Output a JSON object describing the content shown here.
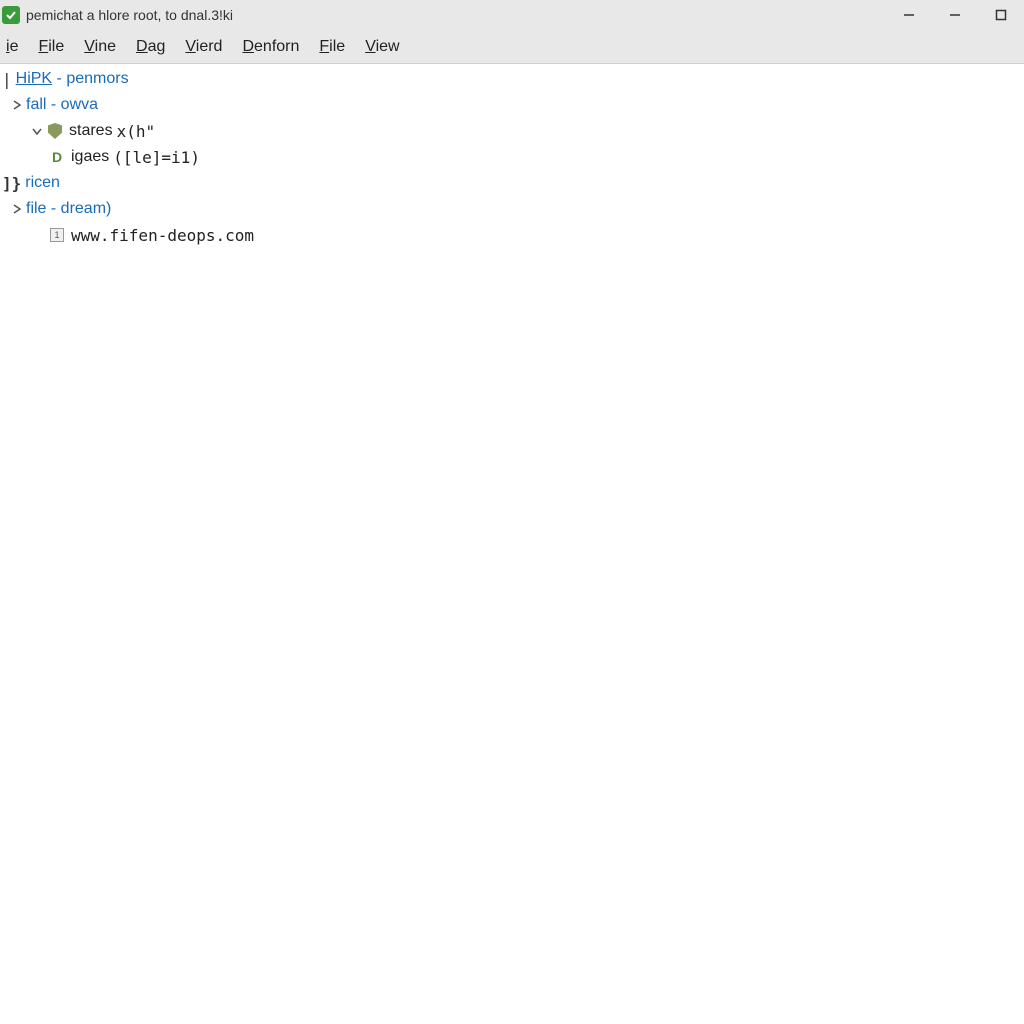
{
  "window": {
    "title": "pemichat a hlore root, to dnal.3!ki"
  },
  "menubar": {
    "items": [
      {
        "prefix": "",
        "ul": "i",
        "rest": "e"
      },
      {
        "prefix": "",
        "ul": "F",
        "rest": "ile"
      },
      {
        "prefix": "",
        "ul": "V",
        "rest": "ine"
      },
      {
        "prefix": "",
        "ul": "D",
        "rest": "ag"
      },
      {
        "prefix": "",
        "ul": "V",
        "rest": "ierd"
      },
      {
        "prefix": "",
        "ul": "D",
        "rest": "enforn"
      },
      {
        "prefix": "",
        "ul": "F",
        "rest": "ile"
      },
      {
        "prefix": "",
        "ul": "V",
        "rest": "iew"
      }
    ]
  },
  "tree": {
    "root1": {
      "label_link": "HiPK",
      "label_rest": " - penmors"
    },
    "node1": {
      "label": "fall - owva"
    },
    "node2": {
      "label": "stares",
      "ext": "x(h\""
    },
    "node3": {
      "label": "igaes",
      "ext": "([le]=i1)"
    },
    "root2": {
      "label": "ricen"
    },
    "node4": {
      "label": "file - dream)"
    },
    "node5": {
      "label": "www.fifen-deops.com"
    }
  }
}
